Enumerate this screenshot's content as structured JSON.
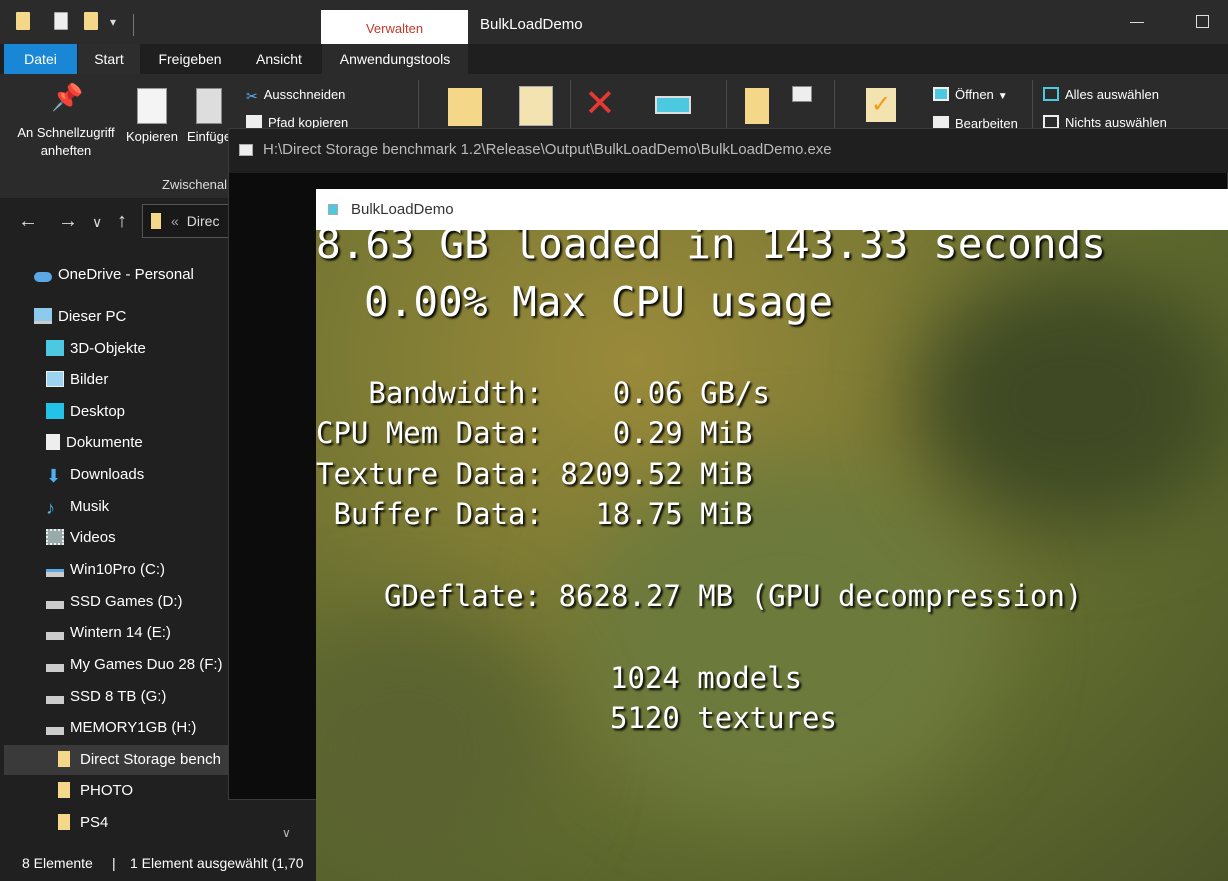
{
  "explorer": {
    "title": "BulkLoadDemo",
    "context_tab_header": "Verwalten",
    "tabs": [
      "Datei",
      "Start",
      "Freigeben",
      "Ansicht",
      "Anwendungstools"
    ],
    "ribbon": {
      "pin_label": "An Schnellzugriff anheften",
      "copy_label": "Kopieren",
      "paste_label": "Einfüge",
      "cut_label": "Ausschneiden",
      "copy_path_label": "Pfad kopieren",
      "group_label": "Zwischenal",
      "open_label": "Öffnen",
      "edit_label": "Bearbeiten",
      "select_all_label": "Alles auswählen",
      "select_none_label": "Nichts auswählen"
    },
    "address_text": "Direc",
    "sidebar": {
      "items": [
        {
          "label": "OneDrive - Personal",
          "icon": "cloud-icon"
        },
        {
          "label": "Dieser PC",
          "icon": "computer-icon"
        },
        {
          "label": "3D-Objekte",
          "icon": "cube-icon"
        },
        {
          "label": "Bilder",
          "icon": "image-icon"
        },
        {
          "label": "Desktop",
          "icon": "desktop-icon"
        },
        {
          "label": "Dokumente",
          "icon": "document-icon"
        },
        {
          "label": "Downloads",
          "icon": "download-icon"
        },
        {
          "label": "Musik",
          "icon": "music-icon"
        },
        {
          "label": "Videos",
          "icon": "video-icon"
        },
        {
          "label": "Win10Pro (C:)",
          "icon": "drive-icon"
        },
        {
          "label": "SSD Games (D:)",
          "icon": "drive-icon"
        },
        {
          "label": "Wintern 14 (E:)",
          "icon": "drive-icon"
        },
        {
          "label": "My Games Duo 28 (F:)",
          "icon": "drive-icon"
        },
        {
          "label": "SSD 8 TB (G:)",
          "icon": "drive-icon"
        },
        {
          "label": "MEMORY1GB (H:)",
          "icon": "drive-icon"
        },
        {
          "label": "Direct Storage bench",
          "icon": "folder-icon"
        },
        {
          "label": "PHOTO",
          "icon": "folder-icon"
        },
        {
          "label": "PS4",
          "icon": "folder-icon"
        }
      ]
    },
    "status": {
      "count": "8 Elemente",
      "separator": "|",
      "selected": "1 Element ausgewählt (1,70"
    }
  },
  "console": {
    "title": "H:\\Direct Storage benchmark 1.2\\Release\\Output\\BulkLoadDemo\\BulkLoadDemo.exe"
  },
  "demo": {
    "title": "BulkLoadDemo",
    "headline": "8.63 GB loaded in 143.33 seconds",
    "cpu_line": "0.00% Max CPU usage",
    "stats": {
      "bandwidth": "   Bandwidth:    0.06 GB/s",
      "cpu_mem": "CPU Mem Data:    0.29 MiB",
      "texture": "Texture Data: 8209.52 MiB",
      "buffer": " Buffer Data:   18.75 MiB"
    },
    "gdeflate": "GDeflate: 8628.27 MB (GPU decompression)",
    "models": "1024 models",
    "textures": "5120 textures"
  }
}
